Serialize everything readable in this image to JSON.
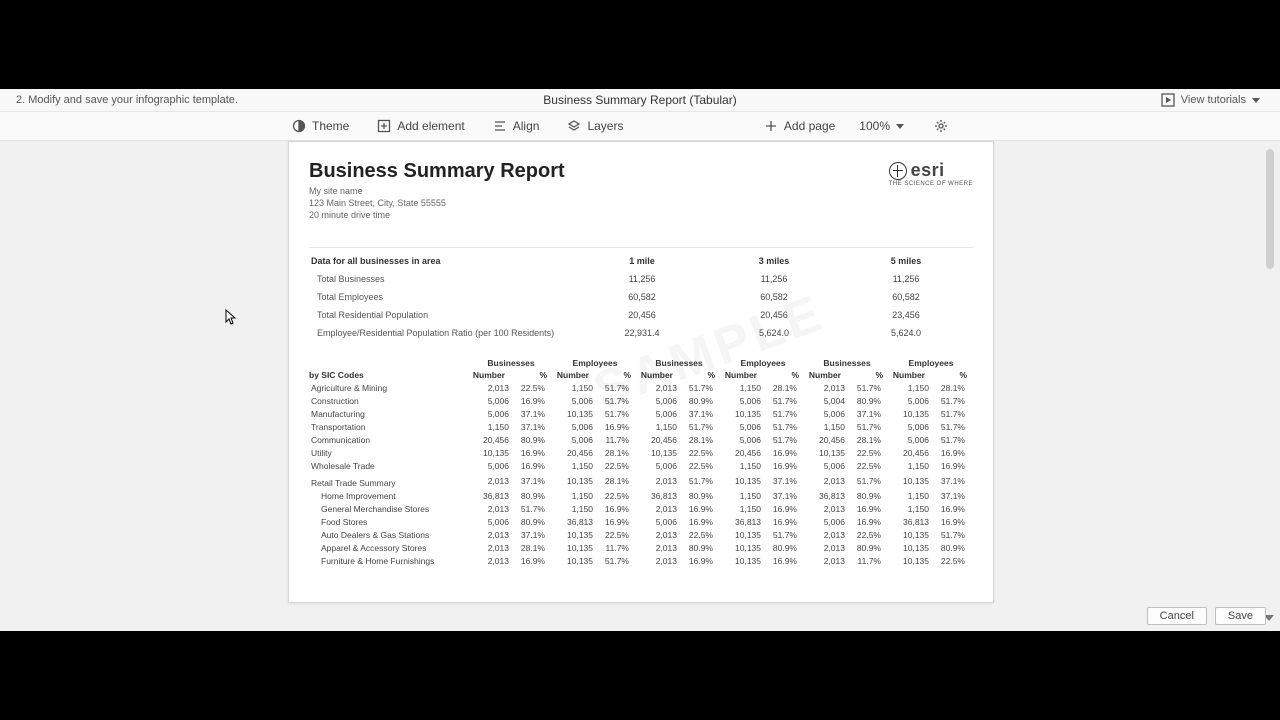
{
  "topbar": {
    "step": "2.  Modify and save your infographic template.",
    "doc_title": "Business Summary Report (Tabular)",
    "view_tutorials": "View tutorials"
  },
  "toolbar": {
    "theme": "Theme",
    "add_element": "Add element",
    "align": "Align",
    "layers": "Layers",
    "add_page": "Add page",
    "zoom": "100%"
  },
  "report": {
    "title": "Business Summary Report",
    "site": "My site name",
    "address": "123 Main Street, City, State 55555",
    "radius": "20 minute drive time",
    "logo_text": "esri",
    "logo_tag": "THE SCIENCE OF WHERE"
  },
  "summary": {
    "header": "Data for all businesses in area",
    "cols": [
      "1 mile",
      "3 miles",
      "5 miles"
    ],
    "rows": [
      {
        "label": "Total Businesses",
        "v": [
          "11,256",
          "11,256",
          "11,256"
        ]
      },
      {
        "label": "Total Employees",
        "v": [
          "60,582",
          "60,582",
          "60,582"
        ]
      },
      {
        "label": "Total Residential Population",
        "v": [
          "20,456",
          "20,456",
          "23,456"
        ]
      },
      {
        "label": "Employee/Residential Population Ratio (per 100 Residents)",
        "v": [
          "22,931.4",
          "5,624.0",
          "5,624.0"
        ]
      }
    ]
  },
  "sic": {
    "group_labels": [
      "Businesses",
      "Employees",
      "Businesses",
      "Employees",
      "Businesses",
      "Employees"
    ],
    "sub_labels": {
      "first": "by SIC Codes",
      "num": "Number",
      "pct": "%"
    },
    "rows": [
      {
        "label": "Agriculture & Mining",
        "cells": [
          "2,013",
          "22.5%",
          "1,150",
          "51.7%",
          "2,013",
          "51.7%",
          "1,150",
          "28.1%",
          "2,013",
          "51.7%",
          "1,150",
          "28.1%"
        ]
      },
      {
        "label": "Construction",
        "cells": [
          "5,006",
          "16.9%",
          "5,006",
          "51.7%",
          "5,006",
          "80.9%",
          "5,006",
          "51.7%",
          "5,004",
          "80.9%",
          "5,006",
          "51.7%"
        ]
      },
      {
        "label": "Manufacturing",
        "cells": [
          "5,006",
          "37.1%",
          "10,135",
          "51.7%",
          "5,006",
          "37.1%",
          "10,135",
          "51.7%",
          "5,006",
          "37.1%",
          "10,135",
          "51.7%"
        ]
      },
      {
        "label": "Transportation",
        "cells": [
          "1,150",
          "37.1%",
          "5,006",
          "16.9%",
          "1,150",
          "51.7%",
          "5,006",
          "51.7%",
          "1,150",
          "51.7%",
          "5,006",
          "51.7%"
        ]
      },
      {
        "label": "Communication",
        "cells": [
          "20,456",
          "80.9%",
          "5,006",
          "11.7%",
          "20,456",
          "28.1%",
          "5,006",
          "51.7%",
          "20,456",
          "28.1%",
          "5,006",
          "51.7%"
        ]
      },
      {
        "label": "Utility",
        "cells": [
          "10,135",
          "16.9%",
          "20,456",
          "28.1%",
          "10,135",
          "22.5%",
          "20,456",
          "16.9%",
          "10,135",
          "22.5%",
          "20,456",
          "16.9%"
        ]
      },
      {
        "label": "Wholesale Trade",
        "cells": [
          "5,006",
          "16.9%",
          "1,150",
          "22.5%",
          "5,006",
          "22.5%",
          "1,150",
          "16.9%",
          "5,006",
          "22.5%",
          "1,150",
          "16.9%"
        ]
      }
    ],
    "section2_label": "Retail Trade Summary",
    "section2_cells": [
      "2,013",
      "37.1%",
      "10,135",
      "28.1%",
      "2,013",
      "51.7%",
      "10,135",
      "37.1%",
      "2,013",
      "51.7%",
      "10,135",
      "37.1%"
    ],
    "rows2": [
      {
        "label": "Home Improvement",
        "cells": [
          "36,813",
          "80.9%",
          "1,150",
          "22.5%",
          "36,813",
          "80.9%",
          "1,150",
          "37.1%",
          "36,813",
          "80.9%",
          "1,150",
          "37.1%"
        ]
      },
      {
        "label": "General Merchandise Stores",
        "cells": [
          "2,013",
          "51.7%",
          "1,150",
          "16.9%",
          "2,013",
          "16.9%",
          "1,150",
          "16.9%",
          "2,013",
          "16.9%",
          "1,150",
          "16.9%"
        ]
      },
      {
        "label": "Food Stores",
        "cells": [
          "5,006",
          "80.9%",
          "36,813",
          "16.9%",
          "5,006",
          "16.9%",
          "36,813",
          "16.9%",
          "5,006",
          "16.9%",
          "36,813",
          "16.9%"
        ]
      },
      {
        "label": "Auto Dealers & Gas Stations",
        "cells": [
          "2,013",
          "37.1%",
          "10,135",
          "22.5%",
          "2,013",
          "22.5%",
          "10,135",
          "51.7%",
          "2,013",
          "22.5%",
          "10,135",
          "51.7%"
        ]
      },
      {
        "label": "Apparel & Accessory Stores",
        "cells": [
          "2,013",
          "28.1%",
          "10,135",
          "11.7%",
          "2,013",
          "80.9%",
          "10,135",
          "80.9%",
          "2,013",
          "80.9%",
          "10,135",
          "80.9%"
        ]
      },
      {
        "label": "Furniture & Home Furnishings",
        "cells": [
          "2,013",
          "16.9%",
          "10,135",
          "51.7%",
          "2,013",
          "16.9%",
          "10,135",
          "16.9%",
          "2,013",
          "11.7%",
          "10,135",
          "22.5%"
        ]
      }
    ]
  },
  "footer": {
    "cancel": "Cancel",
    "save": "Save"
  }
}
